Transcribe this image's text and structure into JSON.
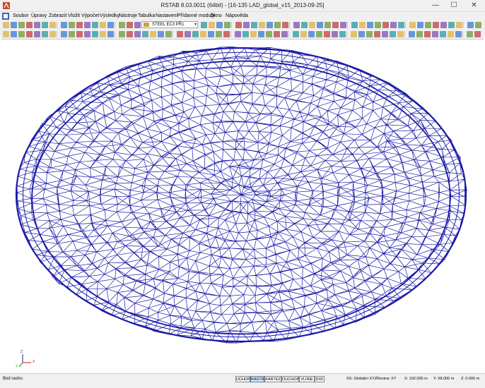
{
  "window": {
    "title": "RSTAB 8.03.0011 (64bit) - [16-135 LAD_global_v15_2013-09-25]",
    "controls": {
      "minimize": "—",
      "maximize": "☐",
      "close": "✕"
    }
  },
  "menubar": {
    "items": [
      "Soubor",
      "Úpravy",
      "Zobrazit",
      "Vložit",
      "Výpočet",
      "Výsledky",
      "Nástroje",
      "Tabulka",
      "Nastavení",
      "Přídavné moduly",
      "Okno",
      "Nápověda"
    ]
  },
  "toolbar": {
    "combo_value": "STEEL EC3 PŘ1",
    "accent": "#2a5bb5"
  },
  "viewport": {
    "structure_color": "#1a1aa6",
    "axes": {
      "x": "X",
      "y": "Y",
      "z": "Z"
    }
  },
  "statusbar": {
    "text": "Bod rastru",
    "toggles": [
      "UCHOP",
      "RASTR",
      "KARTEZ",
      "OUCHOP",
      "VLINIE",
      "DXF"
    ],
    "coordinate_system": "SS: Globální XYZ",
    "plane": "Rovina: XY",
    "x": "X: 102.000 m",
    "y": "Y: 68.000 m",
    "z": "Z: 0.000 m"
  }
}
